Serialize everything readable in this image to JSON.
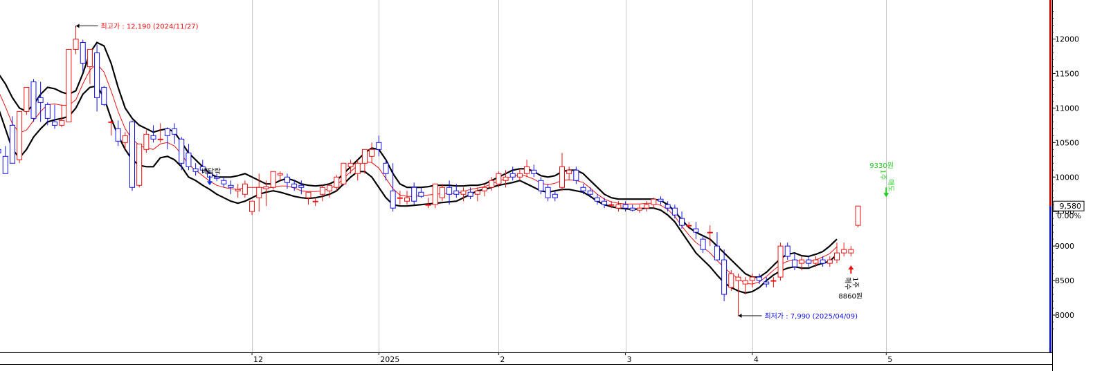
{
  "chart_data": {
    "type": "candlestick",
    "x_ticks": [
      {
        "label": "12",
        "index": 37
      },
      {
        "label": "2025",
        "index": 55
      },
      {
        "label": "2",
        "index": 72
      },
      {
        "label": "3",
        "index": 90
      },
      {
        "label": "4",
        "index": 108
      },
      {
        "label": "5",
        "index": 127
      }
    ],
    "y_ticks": [
      8000,
      8500,
      9000,
      9500,
      10000,
      10500,
      11000,
      11500,
      12000
    ],
    "ylim": [
      7760,
      12450
    ],
    "last_price": "9,580",
    "change_pct": "0.00%",
    "candles": [
      [
        11180,
        11180,
        10280,
        10500
      ],
      [
        10400,
        10550,
        10300,
        10350
      ],
      [
        10300,
        10450,
        10050,
        10050
      ],
      [
        10750,
        10880,
        10200,
        10200
      ],
      [
        10250,
        10950,
        10200,
        10950
      ],
      [
        10950,
        11200,
        10900,
        11300
      ],
      [
        11380,
        11420,
        10800,
        10850
      ],
      [
        11150,
        11380,
        10800,
        11080
      ],
      [
        11050,
        11080,
        10750,
        10850
      ],
      [
        10800,
        11050,
        10700,
        10750
      ],
      [
        10750,
        11050,
        10720,
        10820
      ],
      [
        10800,
        11850,
        10800,
        11850
      ],
      [
        11850,
        12190,
        11780,
        12000
      ],
      [
        11950,
        11990,
        11530,
        11650
      ],
      [
        11600,
        11820,
        11350,
        11850
      ],
      [
        11800,
        11920,
        10950,
        11150
      ],
      [
        11300,
        11320,
        11030,
        11050
      ],
      [
        10800,
        10830,
        10600,
        10800
      ],
      [
        10700,
        10820,
        10450,
        10520
      ],
      [
        10500,
        10650,
        10400,
        10600
      ],
      [
        10800,
        10820,
        9800,
        9850
      ],
      [
        9880,
        10480,
        9850,
        10480
      ],
      [
        10400,
        10680,
        10350,
        10620
      ],
      [
        10600,
        10750,
        10500,
        10550
      ],
      [
        10550,
        10780,
        10500,
        10550
      ],
      [
        10700,
        10720,
        10400,
        10600
      ],
      [
        10700,
        10780,
        10480,
        10620
      ],
      [
        10550,
        10580,
        10100,
        10200
      ],
      [
        10350,
        10480,
        10100,
        10150
      ],
      [
        10120,
        10200,
        10020,
        10080
      ],
      [
        10150,
        10250,
        10050,
        10100
      ],
      [
        10050,
        10100,
        9950,
        10000
      ],
      [
        10000,
        10050,
        9940,
        9980
      ],
      [
        9950,
        10000,
        9850,
        9900
      ],
      [
        9880,
        9950,
        9750,
        9850
      ],
      [
        9800,
        9900,
        9700,
        9820
      ],
      [
        9750,
        9950,
        9700,
        9900
      ],
      [
        9500,
        9620,
        9450,
        9650
      ],
      [
        9700,
        10050,
        9500,
        9850
      ],
      [
        9830,
        9950,
        9580,
        9860
      ],
      [
        9850,
        10080,
        9820,
        10080
      ],
      [
        10030,
        10080,
        9950,
        10050
      ],
      [
        10000,
        10050,
        9830,
        9920
      ],
      [
        9900,
        9960,
        9800,
        9850
      ],
      [
        9880,
        9950,
        9750,
        9850
      ],
      [
        9700,
        9780,
        9600,
        9780
      ],
      [
        9650,
        9700,
        9580,
        9650
      ],
      [
        9750,
        9880,
        9650,
        9850
      ],
      [
        9800,
        9900,
        9700,
        9880
      ],
      [
        9850,
        10030,
        9800,
        10000
      ],
      [
        9900,
        10200,
        9880,
        10200
      ],
      [
        10150,
        10250,
        10050,
        10200
      ],
      [
        10050,
        10250,
        9950,
        10200
      ],
      [
        10200,
        10400,
        10050,
        10400
      ],
      [
        10300,
        10500,
        10200,
        10400
      ],
      [
        10500,
        10600,
        10300,
        10400
      ],
      [
        10200,
        10250,
        9950,
        10050
      ],
      [
        9800,
        10200,
        9500,
        9550
      ],
      [
        9700,
        9800,
        9600,
        9700
      ],
      [
        9650,
        9800,
        9600,
        9700
      ],
      [
        9850,
        9920,
        9600,
        9650
      ],
      [
        9780,
        9850,
        9700,
        9720
      ],
      [
        9600,
        9700,
        9550,
        9600
      ],
      [
        9600,
        9900,
        9550,
        9900
      ],
      [
        9700,
        9900,
        9650,
        9850
      ],
      [
        9850,
        9950,
        9600,
        9750
      ],
      [
        9800,
        9900,
        9700,
        9750
      ],
      [
        9750,
        9850,
        9650,
        9800
      ],
      [
        9780,
        9850,
        9680,
        9720
      ],
      [
        9750,
        9850,
        9650,
        9800
      ],
      [
        9800,
        9900,
        9720,
        9850
      ],
      [
        9850,
        10000,
        9800,
        9950
      ],
      [
        9900,
        10080,
        9850,
        10050
      ],
      [
        9950,
        10100,
        9850,
        10000
      ],
      [
        10050,
        10150,
        9950,
        10000
      ],
      [
        10000,
        10120,
        9950,
        10050
      ],
      [
        10050,
        10250,
        10000,
        10150
      ],
      [
        10100,
        10180,
        10000,
        10050
      ],
      [
        9950,
        10000,
        9750,
        9800
      ],
      [
        9850,
        9900,
        9650,
        9700
      ],
      [
        9750,
        9800,
        9650,
        9700
      ],
      [
        9850,
        10350,
        9800,
        10150
      ],
      [
        10050,
        10150,
        9950,
        10100
      ],
      [
        10100,
        10150,
        9900,
        9950
      ],
      [
        9850,
        9900,
        9750,
        9800
      ],
      [
        9800,
        9850,
        9700,
        9750
      ],
      [
        9700,
        9750,
        9600,
        9650
      ],
      [
        9650,
        9700,
        9550,
        9600
      ],
      [
        9600,
        9650,
        9550,
        9600
      ],
      [
        9550,
        9650,
        9500,
        9600
      ],
      [
        9600,
        9650,
        9500,
        9550
      ],
      [
        9550,
        9600,
        9500,
        9520
      ],
      [
        9520,
        9600,
        9480,
        9550
      ],
      [
        9550,
        9650,
        9500,
        9600
      ],
      [
        9600,
        9700,
        9550,
        9680
      ],
      [
        9680,
        9720,
        9600,
        9650
      ],
      [
        9600,
        9650,
        9500,
        9550
      ],
      [
        9550,
        9600,
        9400,
        9450
      ],
      [
        9400,
        9500,
        9250,
        9300
      ],
      [
        9300,
        9350,
        9250,
        9300
      ],
      [
        9250,
        9350,
        9100,
        9200
      ],
      [
        9100,
        9150,
        8900,
        8950
      ],
      [
        9200,
        9300,
        9000,
        9200
      ],
      [
        9000,
        9200,
        8800,
        8800
      ],
      [
        8800,
        8950,
        8200,
        8300
      ],
      [
        8400,
        8650,
        8350,
        8600
      ],
      [
        8500,
        8600,
        7990,
        8550
      ],
      [
        8450,
        8550,
        8300,
        8500
      ],
      [
        8500,
        8600,
        8400,
        8550
      ],
      [
        8550,
        8600,
        8450,
        8500
      ],
      [
        8480,
        8550,
        8400,
        8450
      ],
      [
        8500,
        8550,
        8400,
        8500
      ],
      [
        8550,
        9050,
        8500,
        9000
      ],
      [
        9000,
        9050,
        8800,
        8850
      ],
      [
        8800,
        8900,
        8650,
        8700
      ],
      [
        8750,
        8850,
        8650,
        8800
      ],
      [
        8800,
        8850,
        8700,
        8750
      ],
      [
        8750,
        8850,
        8700,
        8800
      ],
      [
        8800,
        8850,
        8700,
        8750
      ],
      [
        8750,
        8850,
        8700,
        8800
      ],
      [
        8800,
        9050,
        8750,
        8900
      ],
      [
        8900,
        9050,
        8850,
        8950
      ],
      [
        8900,
        9000,
        8850,
        8950
      ],
      [
        9300,
        9580,
        9270,
        9580
      ]
    ],
    "upper_band": [
      11580,
      11500,
      11350,
      11150,
      11000,
      10950,
      11050,
      11200,
      11300,
      11280,
      11230,
      11200,
      11250,
      11500,
      11800,
      11950,
      11900,
      11650,
      11300,
      11000,
      10850,
      10750,
      10700,
      10650,
      10680,
      10700,
      10650,
      10500,
      10350,
      10250,
      10150,
      10050,
      10000,
      10000,
      10000,
      10020,
      10050,
      10000,
      9950,
      9900,
      9900,
      9950,
      9980,
      9950,
      9900,
      9880,
      9870,
      9880,
      9900,
      9950,
      10050,
      10150,
      10250,
      10350,
      10420,
      10400,
      10250,
      10050,
      9900,
      9850,
      9850,
      9850,
      9860,
      9880,
      9880,
      9880,
      9870,
      9870,
      9880,
      9880,
      9900,
      9950,
      10000,
      10050,
      10100,
      10120,
      10120,
      10080,
      10020,
      10000,
      10020,
      10080,
      10100,
      10100,
      10050,
      9950,
      9850,
      9750,
      9700,
      9680,
      9680,
      9680,
      9680,
      9680,
      9680,
      9660,
      9600,
      9500,
      9380,
      9270,
      9200,
      9150,
      9100,
      9000,
      8900,
      8800,
      8700,
      8600,
      8550,
      8550,
      8620,
      8720,
      8820,
      8880,
      8900,
      8860,
      8850,
      8880,
      8920,
      9000,
      9100
    ],
    "lower_band": [
      11200,
      11000,
      10700,
      10400,
      10280,
      10400,
      10580,
      10700,
      10800,
      10830,
      10850,
      10880,
      11000,
      11200,
      11300,
      11320,
      11150,
      10850,
      10600,
      10400,
      10250,
      10170,
      10150,
      10150,
      10280,
      10300,
      10250,
      10150,
      10000,
      9950,
      9880,
      9820,
      9750,
      9700,
      9650,
      9620,
      9650,
      9700,
      9750,
      9780,
      9800,
      9780,
      9750,
      9720,
      9700,
      9690,
      9700,
      9720,
      9750,
      9800,
      9900,
      10000,
      10080,
      10080,
      10000,
      9850,
      9700,
      9600,
      9580,
      9580,
      9590,
      9600,
      9610,
      9620,
      9630,
      9640,
      9650,
      9700,
      9750,
      9800,
      9820,
      9850,
      9880,
      9900,
      9920,
      9950,
      9900,
      9850,
      9800,
      9780,
      9800,
      9820,
      9820,
      9800,
      9780,
      9720,
      9650,
      9600,
      9570,
      9550,
      9540,
      9530,
      9540,
      9550,
      9550,
      9520,
      9450,
      9350,
      9200,
      9050,
      8900,
      8800,
      8700,
      8580,
      8470,
      8400,
      8350,
      8320,
      8340,
      8400,
      8500,
      8580,
      8640,
      8680,
      8700,
      8680,
      8680,
      8720,
      8750,
      8780,
      8880
    ],
    "mid_line": [
      11380,
      11250,
      11020,
      10770,
      10640,
      10680,
      10820,
      10950,
      11050,
      11060,
      11040,
      11040,
      11120,
      11350,
      11550,
      11640,
      11520,
      11250,
      10950,
      10700,
      10550,
      10460,
      10420,
      10400,
      10480,
      10500,
      10450,
      10330,
      10180,
      10100,
      10020,
      9940,
      9880,
      9850,
      9830,
      9820,
      9850,
      9850,
      9850,
      9840,
      9850,
      9870,
      9870,
      9840,
      9800,
      9790,
      9790,
      9800,
      9830,
      9880,
      9980,
      10080,
      10170,
      10220,
      10210,
      10130,
      9980,
      9830,
      9740,
      9720,
      9720,
      9730,
      9740,
      9750,
      9760,
      9760,
      9760,
      9790,
      9820,
      9840,
      9860,
      9900,
      9940,
      9980,
      10010,
      10040,
      10010,
      9970,
      9910,
      9890,
      9910,
      9950,
      9960,
      9950,
      9920,
      9840,
      9750,
      9680,
      9640,
      9620,
      9610,
      9610,
      9610,
      9620,
      9620,
      9590,
      9530,
      9430,
      9290,
      9160,
      9050,
      8980,
      8900,
      8790,
      8690,
      8600,
      8530,
      8460,
      8450,
      8480,
      8560,
      8650,
      8730,
      8780,
      8800,
      8770,
      8770,
      8800,
      8840,
      8890,
      8990
    ],
    "annotations": [
      {
        "text": "최고가 : 12,190 (2024/11/27)",
        "index": 12,
        "price": 12190,
        "color": "#ee1111",
        "kind": "high"
      },
      {
        "text": "최저가 : 7,990 (2025/04/09)",
        "index": 106,
        "price": 7990,
        "color": "#1111ee",
        "kind": "low"
      },
      {
        "text": "배당락",
        "index": 31,
        "price": 10000,
        "color": "#000000",
        "kind": "event"
      },
      {
        "text": "매수",
        "index": 122,
        "price": 8720,
        "color": "#000000",
        "kind": "buy"
      },
      {
        "text": "1주",
        "index": 122,
        "price": 8720,
        "color": "#000000",
        "kind": "buy"
      },
      {
        "text": "8860원",
        "index": 122,
        "price": 8720,
        "color": "#000000",
        "kind": "buy"
      },
      {
        "text": "9330원",
        "index": 127,
        "price": 9610,
        "color": "#22cc22",
        "kind": "sell"
      },
      {
        "text": "1주",
        "index": 127,
        "price": 9610,
        "color": "#22cc22",
        "kind": "sell"
      },
      {
        "text": "매도",
        "index": 127,
        "price": 9610,
        "color": "#22cc22",
        "kind": "sell"
      }
    ],
    "colors": {
      "up": "#ee1111",
      "down": "#1111ee",
      "band": "#000000",
      "mid": "#ee1111",
      "buy": "#ee1111",
      "sell": "#22cc22",
      "axis_bar": "#cc0000"
    }
  }
}
